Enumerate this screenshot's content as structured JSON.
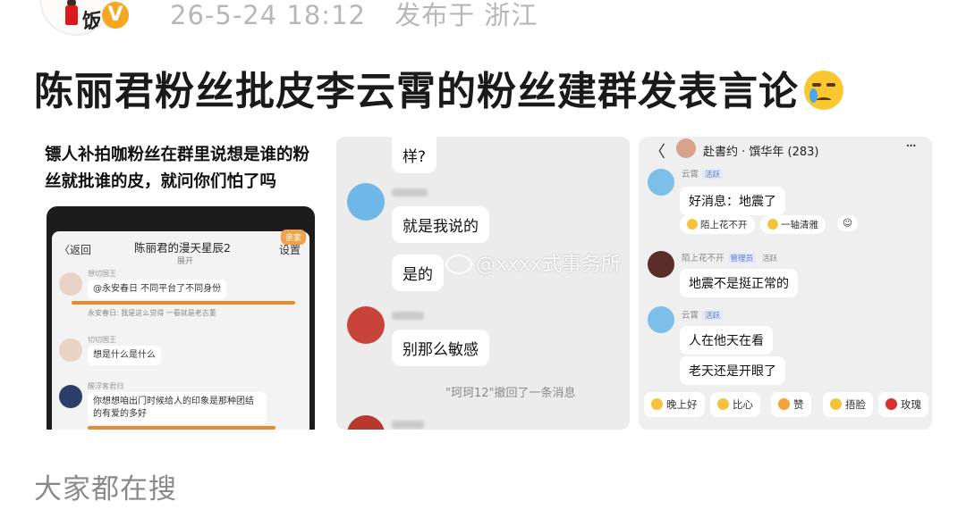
{
  "post": {
    "author_badge": "V",
    "avatar_text": "饭",
    "date": "26-5-24 18:12",
    "source": "发布于 浙江",
    "title": "陈丽君粉丝批皮李云霄的粉丝建群发表言论",
    "title_emoji": "crying-face-emoji"
  },
  "image1": {
    "caption": "镖人补拍咖粉丝在群里说想是谁的粉丝就批谁的皮，就问你们怕了吗",
    "phone": {
      "back": "〈返回",
      "group_title": "陈丽君的漫天星辰2",
      "status": "展开",
      "settings": "设置",
      "badge": "亲家",
      "msg1_name": "想切国王",
      "msg1": "@永安春日 不同平台了不同身份",
      "msg1_quote": "永安春日: 我是这么觉得 一看就是老古董",
      "msg2_name": "切切国王",
      "msg2": "想是什么是什么",
      "msg3_name": "醒浮客君归",
      "msg3": "你想想咱出门时候给人的印象是那种团结的有爱的多好"
    }
  },
  "image2": {
    "msg_top": "样?",
    "msg1": "就是我说的",
    "msg2": "是的",
    "msg3": "别那么敏感",
    "system": "\"珂珂12\"撤回了一条消息"
  },
  "image3": {
    "header": {
      "back": "〈",
      "title": "赴書约 · 馔华年 (283)",
      "more": "···"
    },
    "m1_name": "云霄",
    "m1_tag": "活跃",
    "m1": "好消息：地震了",
    "reactions": [
      "陌上花不开",
      "一轴清雅"
    ],
    "m2_name": "陌上花不开",
    "m2_tag": "管理员",
    "m2_tag2": "活跃",
    "m2": "地震不是挺正常的",
    "m3_name": "云霄",
    "m3_tag": "活跃",
    "m3a": "人在他天在看",
    "m3b": "老天还是开眼了",
    "quick": [
      "晚上好",
      "比心",
      "赞",
      "捂脸",
      "玫瑰"
    ]
  },
  "watermark": "@xxxx式事务所",
  "footer": "大家都在搜"
}
